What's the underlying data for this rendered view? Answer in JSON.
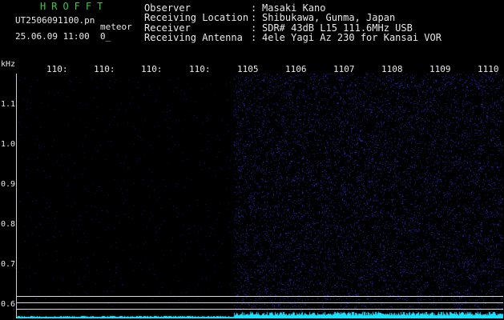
{
  "header": {
    "brand": "HROFFT",
    "file_name": "UT2506091100.pn",
    "file_type": "meteor",
    "timestamp": "25.06.09 11:00",
    "count": "0_",
    "info": [
      {
        "label": "Observer",
        "value": "Masaki Kano"
      },
      {
        "label": "Receiving Location",
        "value": "Shibukawa, Gunma, Japan"
      },
      {
        "label": "Receiver",
        "value": "SDR# 43dB L15 111.6MHz USB"
      },
      {
        "label": "Receiving Antenna",
        "value": "4ele Yagi Az 230 for Kansai VOR"
      }
    ]
  },
  "axis": {
    "unit": "kHz",
    "x_labels": [
      "110:",
      "110:",
      "110:",
      "110:",
      "1105",
      "1106",
      "1107",
      "1108",
      "1109",
      "1110"
    ],
    "y_labels": [
      "1.1",
      "1.0",
      "0.9",
      "0.8",
      "0.7",
      "0.6"
    ]
  },
  "colors": {
    "background": "#000000",
    "noise": "#2a2ad8",
    "baseline": "#1ee0ff",
    "brand": "#3ec83e"
  }
}
